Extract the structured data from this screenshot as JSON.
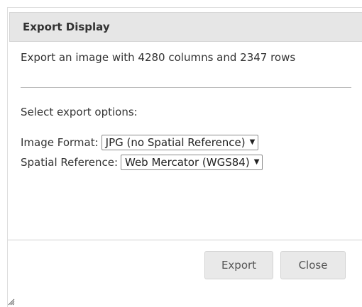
{
  "dialog": {
    "title": "Export Display",
    "info_text": "Export an image with 4280 columns and 2347 rows",
    "subhead": "Select export options:",
    "fields": [
      {
        "label": "Image Format:",
        "value": "JPG (no Spatial Reference)",
        "icon": "chevron-down-icon"
      },
      {
        "label": "Spatial Reference:",
        "value": "Web Mercator (WGS84)",
        "icon": "chevron-down-icon"
      }
    ],
    "buttons": {
      "export_label": "Export",
      "close_label": "Close"
    }
  }
}
